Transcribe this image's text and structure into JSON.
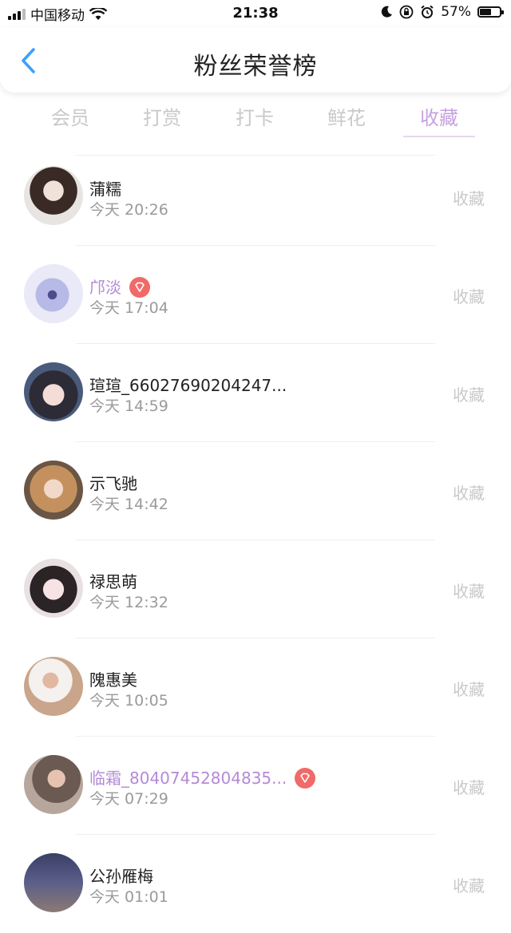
{
  "status_bar": {
    "carrier": "中国移动",
    "time": "21:38",
    "battery_percent": "57%"
  },
  "header": {
    "title": "粉丝荣誉榜"
  },
  "tabs": [
    {
      "label": "会员",
      "active": false
    },
    {
      "label": "打赏",
      "active": false
    },
    {
      "label": "打卡",
      "active": false
    },
    {
      "label": "鲜花",
      "active": false
    },
    {
      "label": "收藏",
      "active": true
    }
  ],
  "colors": {
    "accent": "#c7a1e0",
    "vip_name": "#b48ad6",
    "vip_badge": "#f06a6a",
    "back_arrow": "#3aa0ff"
  },
  "fans": [
    {
      "name": "蒲糯",
      "time": "今天 20:26",
      "action": "收藏",
      "vip": false
    },
    {
      "name": "邝淡",
      "time": "今天 17:04",
      "action": "收藏",
      "vip": true
    },
    {
      "name": "瑄瑄_66027690204247...",
      "time": "今天 14:59",
      "action": "收藏",
      "vip": false
    },
    {
      "name": "示飞驰",
      "time": "今天 14:42",
      "action": "收藏",
      "vip": false
    },
    {
      "name": "禄思萌",
      "time": "今天 12:32",
      "action": "收藏",
      "vip": false
    },
    {
      "name": "隗惠美",
      "time": "今天 10:05",
      "action": "收藏",
      "vip": false
    },
    {
      "name": "临霜_80407452804835...",
      "time": "今天 07:29",
      "action": "收藏",
      "vip": true
    },
    {
      "name": "公孙雁梅",
      "time": "今天 01:01",
      "action": "收藏",
      "vip": false
    }
  ]
}
